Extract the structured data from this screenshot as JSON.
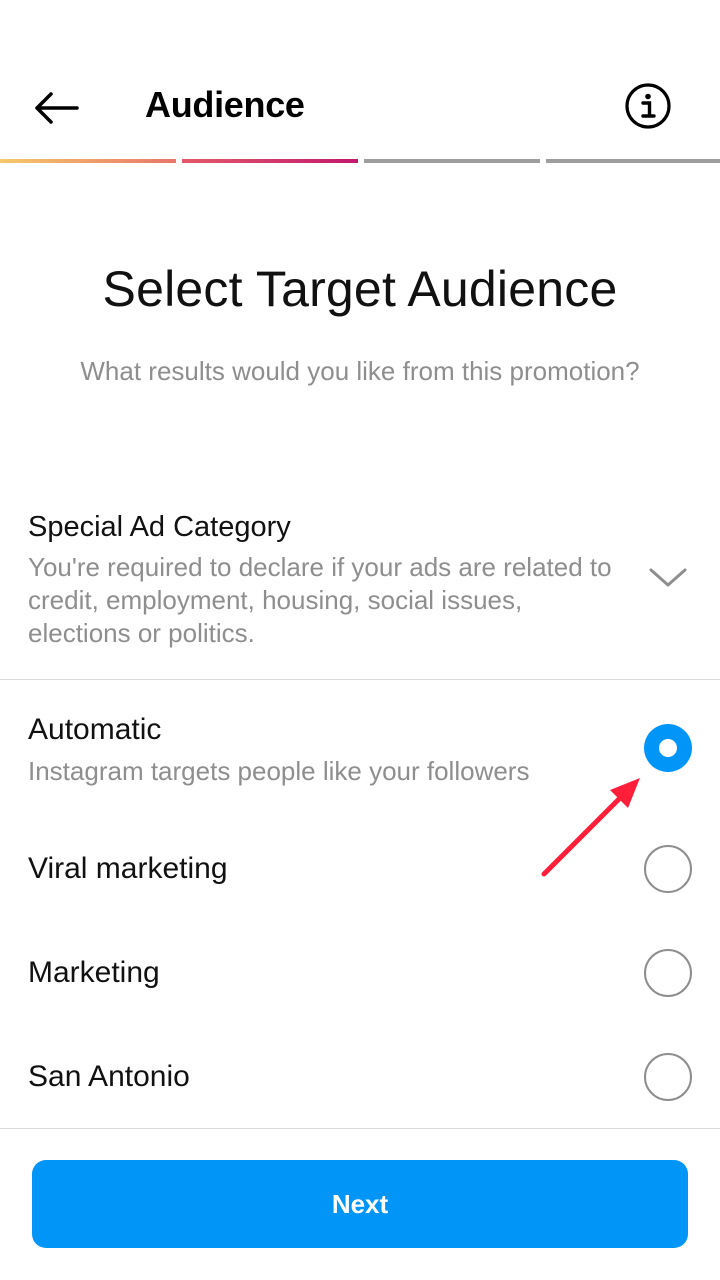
{
  "header": {
    "title": "Audience",
    "back_icon": "arrow-left-icon",
    "info_icon": "info-circle-icon"
  },
  "progress": {
    "total_steps": 4,
    "completed_steps": 2,
    "colors": {
      "step1": "#f5c86a",
      "step2": "#c2186e",
      "inactive": "#9e9e9e"
    }
  },
  "main": {
    "title": "Select Target Audience",
    "subtitle": "What results would you like from this promotion?"
  },
  "special_ad": {
    "title": "Special Ad Category",
    "description": "You're required to declare if your ads are related to credit, employment, housing, social issues, elections or politics.",
    "icon": "chevron-down-icon"
  },
  "options": [
    {
      "label": "Automatic",
      "description": "Instagram targets people like your followers",
      "selected": true
    },
    {
      "label": "Viral marketing",
      "selected": false
    },
    {
      "label": "Marketing",
      "selected": false
    },
    {
      "label": "San Antonio",
      "selected": false
    }
  ],
  "footer": {
    "next_label": "Next"
  },
  "colors": {
    "accent": "#0095f6",
    "annotation": "#ff1f3a",
    "secondary_text": "#8e8e8e"
  }
}
